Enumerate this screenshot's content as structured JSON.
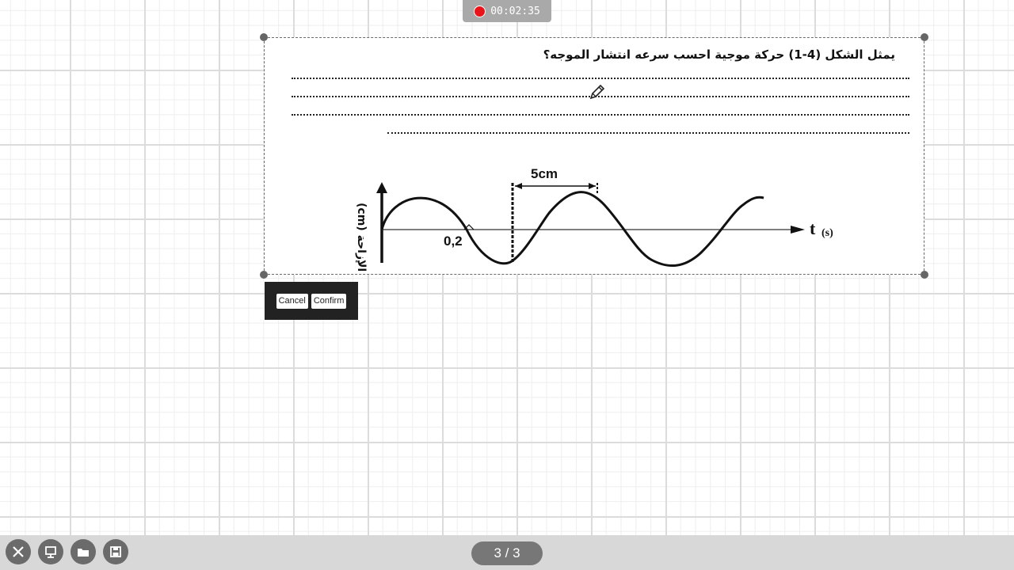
{
  "recording": {
    "time": "00:02:35"
  },
  "content": {
    "question": "يمثل الشكل (4-1) حركة موجية احسب  سرعه انتشار الموجه؟",
    "figure": {
      "wavelength_label": "5cm",
      "time_label": "0,2",
      "x_axis_label": "t",
      "x_axis_unit": "(s)",
      "y_axis_label": "(cm) الإزاحة"
    }
  },
  "toolbar": {
    "cancel_label": "Cancel",
    "confirm_label": "Confirm"
  },
  "footer": {
    "page_indicator": "3 / 3"
  },
  "icons": [
    "close-icon",
    "present-icon",
    "folder-icon",
    "save-icon",
    "pencil-icon"
  ]
}
